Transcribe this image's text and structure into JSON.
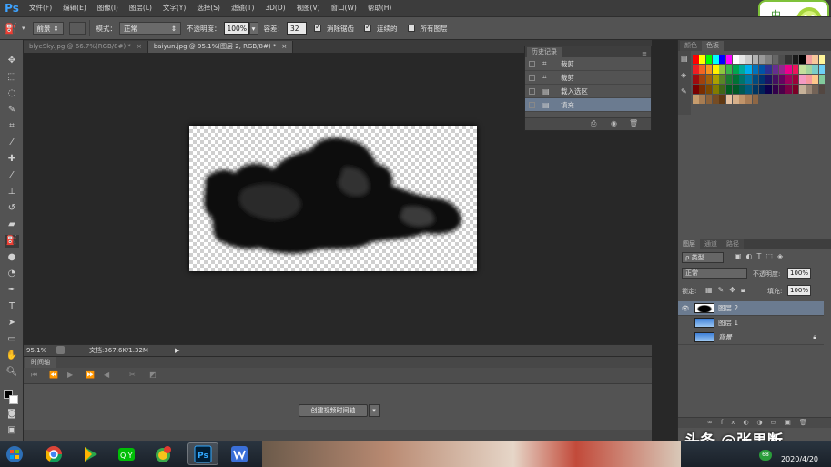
{
  "app": {
    "name": "Ps"
  },
  "menu": [
    "文件(F)",
    "编辑(E)",
    "图像(I)",
    "图层(L)",
    "文字(Y)",
    "选择(S)",
    "滤镜(T)",
    "3D(D)",
    "视图(V)",
    "窗口(W)",
    "帮助(H)"
  ],
  "options": {
    "fill_source": "前景",
    "mode_label": "模式：",
    "mode_value": "正常",
    "opacity_label": "不透明度：",
    "opacity_value": "100%",
    "tolerance_label": "容差：",
    "tolerance_value": "32",
    "antialias_label": "消除锯齿",
    "contiguous_label": "连续的",
    "all_layers_label": "所有图层",
    "antialias_checked": true,
    "contiguous_checked": true,
    "all_layers_checked": false
  },
  "doc_tabs": [
    {
      "label": "blyeSky.jpg @ 66.7%(RGB/8#) *",
      "active": false
    },
    {
      "label": "baiyun.jpg @ 95.1%(图层 2, RGB/8#) *",
      "active": true
    }
  ],
  "status": {
    "zoom": "95.1%",
    "doc_info": "文档:367.6K/1.32M"
  },
  "timeline": {
    "title": "时间轴",
    "create_button": "创建视频时间轴"
  },
  "history": {
    "title": "历史记录",
    "items": [
      {
        "label": "裁剪",
        "icon": "crop",
        "selected": false
      },
      {
        "label": "裁剪",
        "icon": "crop",
        "selected": false
      },
      {
        "label": "载入选区",
        "icon": "doc",
        "selected": false
      },
      {
        "label": "填充",
        "icon": "doc",
        "selected": true
      }
    ]
  },
  "swatches_panel": {
    "tabs": [
      "颜色",
      "色板"
    ]
  },
  "layers_panel": {
    "tabs": [
      "图层",
      "通道",
      "路径"
    ],
    "filter_label": "ρ 类型",
    "blend_mode": "正常",
    "opacity_label": "不透明度:",
    "opacity_value": "100%",
    "lock_label": "锁定:",
    "fill_label": "填充:",
    "fill_value": "100%",
    "layers": [
      {
        "name": "图层 2",
        "visible": true,
        "selected": true,
        "thumb": "cloud-black"
      },
      {
        "name": "图层 1",
        "visible": false,
        "selected": false,
        "thumb": "sky"
      },
      {
        "name": "背景",
        "visible": false,
        "selected": false,
        "thumb": "sky",
        "locked": true
      }
    ]
  },
  "watermark": {
    "text": "头条 @张果断"
  },
  "clock": {
    "date": "2020/4/20"
  },
  "badge": {
    "text": "中"
  },
  "colors": {
    "accent": "#3ea3ff",
    "selection": "#6b7b90",
    "panel": "#535353",
    "bg": "#282828"
  }
}
